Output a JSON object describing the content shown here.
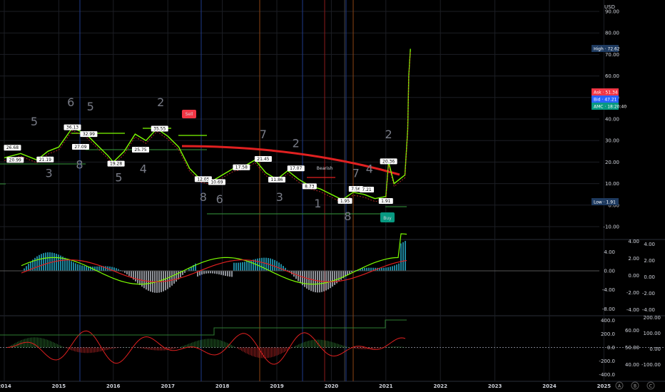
{
  "currency": "USD",
  "colors": {
    "background": "#000000",
    "grid": "#1c1e24",
    "price_line": "#7cfc00",
    "trend_red": "#e02020",
    "ask": "#f23645",
    "bid": "#2962ff",
    "amc": "#089981",
    "high_badge": "#1e3a5f",
    "low_badge": "#1e3a5f"
  },
  "badges": {
    "high": {
      "label": "High",
      "value": "72.62"
    },
    "ask": {
      "label": "Ask",
      "value": "51.34"
    },
    "bid": {
      "label": "Bid",
      "value": "47.21"
    },
    "amc": {
      "label": "AMC",
      "value": "18:20:40"
    },
    "low": {
      "label": "Low",
      "value": "1.91"
    }
  },
  "signals": {
    "sell": "Sell",
    "buy": "Buy",
    "bearish": "Bearish"
  },
  "chart_data": [
    {
      "type": "line",
      "panel": "price",
      "ylim": [
        -10,
        90
      ],
      "yticks": [
        "90.00",
        "80.00",
        "70.00",
        "60.00",
        "50.00",
        "40.00",
        "30.00",
        "20.00",
        "10.00",
        "0.00",
        "-10.00"
      ],
      "x_labels": [
        "2014",
        "2015",
        "2016",
        "2017",
        "2018",
        "2019",
        "2020",
        "2021",
        "2022",
        "2023",
        "2024",
        "2025"
      ],
      "series": [
        {
          "values": [
            [
              2014.0,
              22
            ],
            [
              2014.3,
              24
            ],
            [
              2014.6,
              21
            ],
            [
              2014.8,
              25
            ],
            [
              2015.0,
              27
            ],
            [
              2015.25,
              36
            ],
            [
              2015.5,
              33
            ],
            [
              2015.7,
              28
            ],
            [
              2015.9,
              23
            ],
            [
              2016.0,
              20
            ],
            [
              2016.2,
              25
            ],
            [
              2016.4,
              33
            ],
            [
              2016.6,
              30
            ],
            [
              2016.8,
              35.55
            ],
            [
              2017.0,
              32
            ],
            [
              2017.2,
              27
            ],
            [
              2017.4,
              17
            ],
            [
              2017.6,
              12
            ],
            [
              2017.8,
              11
            ],
            [
              2018.0,
              14
            ],
            [
              2018.2,
              17
            ],
            [
              2018.4,
              18
            ],
            [
              2018.6,
              21
            ],
            [
              2018.8,
              15
            ],
            [
              2019.0,
              12
            ],
            [
              2019.2,
              16
            ],
            [
              2019.4,
              12
            ],
            [
              2019.6,
              9
            ],
            [
              2019.8,
              7.5
            ],
            [
              2020.0,
              5
            ],
            [
              2020.2,
              2.5
            ],
            [
              2020.4,
              6
            ],
            [
              2020.6,
              5
            ],
            [
              2020.8,
              3
            ],
            [
              2021.0,
              4
            ],
            [
              2021.05,
              20
            ],
            [
              2021.15,
              10
            ],
            [
              2021.25,
              12
            ],
            [
              2021.35,
              14
            ],
            [
              2021.4,
              35
            ],
            [
              2021.42,
              60
            ],
            [
              2021.45,
              72.62
            ]
          ]
        }
      ],
      "annotations": [
        {
          "x": 2014.15,
          "y": 26.68,
          "text": "26.68"
        },
        {
          "x": 2014.2,
          "y": 20.99,
          "text": "20.99"
        },
        {
          "x": 2014.75,
          "y": 21.19,
          "text": "21.19"
        },
        {
          "x": 2015.25,
          "y": 36.13,
          "text": "36.13"
        },
        {
          "x": 2015.4,
          "y": 27.09,
          "text": "27.09"
        },
        {
          "x": 2015.55,
          "y": 32.99,
          "text": "32.99"
        },
        {
          "x": 2016.05,
          "y": 19.28,
          "text": "19.28"
        },
        {
          "x": 2016.5,
          "y": 25.75,
          "text": "25.75"
        },
        {
          "x": 2016.85,
          "y": 35.55,
          "text": "35.55"
        },
        {
          "x": 2017.65,
          "y": 12.05,
          "text": "12.05"
        },
        {
          "x": 2017.9,
          "y": 10.69,
          "text": "10.69"
        },
        {
          "x": 2018.35,
          "y": 17.58,
          "text": "17.58"
        },
        {
          "x": 2018.75,
          "y": 21.45,
          "text": "21.45"
        },
        {
          "x": 2019.0,
          "y": 11.86,
          "text": "11.86"
        },
        {
          "x": 2019.35,
          "y": 17.07,
          "text": "17.07"
        },
        {
          "x": 2019.6,
          "y": 8.73,
          "text": "8.73"
        },
        {
          "x": 2020.25,
          "y": 1.95,
          "text": "1.95"
        },
        {
          "x": 2020.45,
          "y": 7.56,
          "text": "7.56"
        },
        {
          "x": 2020.65,
          "y": 7.21,
          "text": "7.21"
        },
        {
          "x": 2021.0,
          "y": 1.91,
          "text": "1.91"
        },
        {
          "x": 2021.05,
          "y": 20.36,
          "text": "20.36"
        }
      ],
      "wave_labels": [
        {
          "x": 2014.55,
          "y": 37,
          "text": "5"
        },
        {
          "x": 2014.82,
          "y": 13,
          "text": "3"
        },
        {
          "x": 2015.22,
          "y": 46,
          "text": "6"
        },
        {
          "x": 2015.38,
          "y": 17,
          "text": "8"
        },
        {
          "x": 2015.58,
          "y": 44,
          "text": "5"
        },
        {
          "x": 2016.1,
          "y": 11,
          "text": "5"
        },
        {
          "x": 2016.55,
          "y": 15,
          "text": "4"
        },
        {
          "x": 2016.87,
          "y": 46,
          "text": "2"
        },
        {
          "x": 2017.65,
          "y": 2,
          "text": "8"
        },
        {
          "x": 2017.95,
          "y": 1,
          "text": "6"
        },
        {
          "x": 2018.75,
          "y": 31,
          "text": "7"
        },
        {
          "x": 2019.05,
          "y": 2,
          "text": "3"
        },
        {
          "x": 2019.35,
          "y": 27,
          "text": "2"
        },
        {
          "x": 2019.75,
          "y": -1,
          "text": "1"
        },
        {
          "x": 2020.45,
          "y": 13,
          "text": "7"
        },
        {
          "x": 2020.7,
          "y": 15,
          "text": "4"
        },
        {
          "x": 2020.3,
          "y": -7,
          "text": "8"
        },
        {
          "x": 2021.05,
          "y": 31,
          "text": "2"
        }
      ]
    },
    {
      "type": "area",
      "panel": "oscillator",
      "ylim": [
        -9,
        6
      ],
      "yticks": [
        "4.00",
        "0.00",
        "-4.00",
        "-8.00"
      ],
      "right_ticks_a": [
        "4.00",
        "2.00",
        "0.00",
        "-2.00",
        "-4.00"
      ],
      "right_ticks_b": [
        "4.00",
        "2.00",
        "0.00",
        "-2.00",
        "-4.00"
      ]
    },
    {
      "type": "bar",
      "panel": "momentum",
      "yticks": [
        "400.0",
        "200.0",
        "0.0",
        "-200.0",
        "-400.0"
      ],
      "right_ticks_a": [
        "60.00",
        "50.00",
        "40.00"
      ],
      "right_ticks_b": [
        "200.00",
        "100.00",
        "0.00",
        "-100.00"
      ]
    }
  ],
  "timeline_letters": [
    "A",
    "B",
    "C"
  ]
}
